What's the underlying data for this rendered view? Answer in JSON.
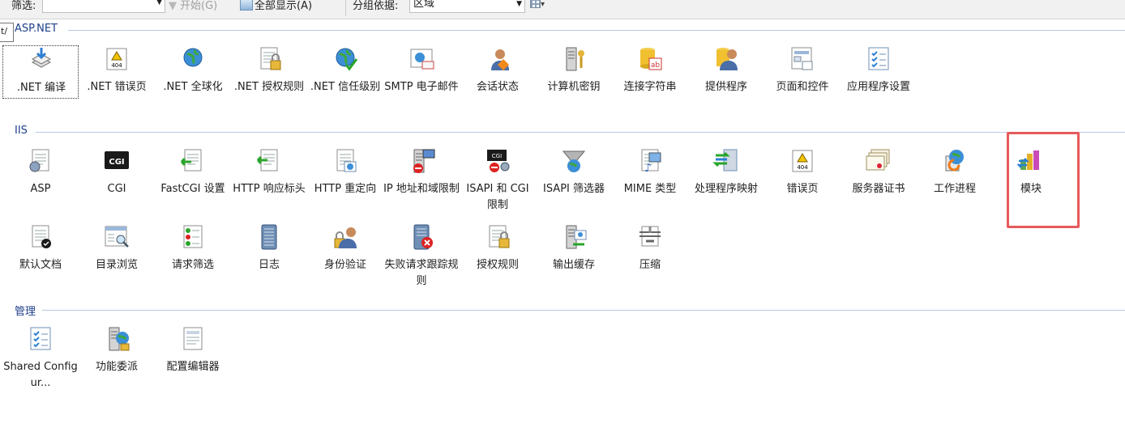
{
  "toolbar": {
    "filter_label": "筛选:",
    "go_label": "开始(G)",
    "show_all_label": "全部显示(A)",
    "group_by_label": "分组依据:",
    "group_by_value": "区域"
  },
  "tooltip_stub": "t/",
  "sections": [
    {
      "title": "ASP.NET",
      "items": [
        {
          "label": ".NET 编译",
          "icon": "net-compile-icon"
        },
        {
          "label": ".NET 错误页",
          "icon": "net-error-pages-icon"
        },
        {
          "label": ".NET 全球化",
          "icon": "net-globalization-icon"
        },
        {
          "label": ".NET 授权规则",
          "icon": "net-authorization-icon"
        },
        {
          "label": ".NET 信任级别",
          "icon": "net-trust-levels-icon"
        },
        {
          "label": "SMTP 电子邮件",
          "icon": "smtp-email-icon"
        },
        {
          "label": "会话状态",
          "icon": "session-state-icon"
        },
        {
          "label": "计算机密钥",
          "icon": "machine-key-icon"
        },
        {
          "label": "连接字符串",
          "icon": "connection-strings-icon"
        },
        {
          "label": "提供程序",
          "icon": "providers-icon"
        },
        {
          "label": "页面和控件",
          "icon": "pages-controls-icon"
        },
        {
          "label": "应用程序设置",
          "icon": "app-settings-icon"
        }
      ]
    },
    {
      "title": "IIS",
      "items": [
        {
          "label": "ASP",
          "icon": "asp-icon"
        },
        {
          "label": "CGI",
          "icon": "cgi-icon"
        },
        {
          "label": "FastCGI 设置",
          "icon": "fastcgi-icon"
        },
        {
          "label": "HTTP 响应标头",
          "icon": "http-response-headers-icon"
        },
        {
          "label": "HTTP 重定向",
          "icon": "http-redirect-icon"
        },
        {
          "label": "IP 地址和域限制",
          "icon": "ip-restrictions-icon"
        },
        {
          "label": "ISAPI 和 CGI 限制",
          "icon": "isapi-cgi-restrictions-icon"
        },
        {
          "label": "ISAPI 筛选器",
          "icon": "isapi-filters-icon"
        },
        {
          "label": "MIME 类型",
          "icon": "mime-types-icon"
        },
        {
          "label": "处理程序映射",
          "icon": "handler-mappings-icon"
        },
        {
          "label": "错误页",
          "icon": "error-pages-icon"
        },
        {
          "label": "服务器证书",
          "icon": "server-certificates-icon"
        },
        {
          "label": "工作进程",
          "icon": "worker-processes-icon"
        },
        {
          "label": "模块",
          "icon": "modules-icon"
        },
        {
          "label": "默认文档",
          "icon": "default-document-icon"
        },
        {
          "label": "目录浏览",
          "icon": "directory-browsing-icon"
        },
        {
          "label": "请求筛选",
          "icon": "request-filtering-icon"
        },
        {
          "label": "日志",
          "icon": "logging-icon"
        },
        {
          "label": "身份验证",
          "icon": "authentication-icon"
        },
        {
          "label": "失败请求跟踪规则",
          "icon": "failed-request-tracing-icon"
        },
        {
          "label": "授权规则",
          "icon": "authorization-rules-icon"
        },
        {
          "label": "输出缓存",
          "icon": "output-caching-icon"
        },
        {
          "label": "压缩",
          "icon": "compression-icon"
        }
      ]
    },
    {
      "title": "管理",
      "items": [
        {
          "label": "Shared Configur...",
          "icon": "shared-configuration-icon"
        },
        {
          "label": "功能委派",
          "icon": "feature-delegation-icon"
        },
        {
          "label": "配置编辑器",
          "icon": "configuration-editor-icon"
        }
      ]
    }
  ],
  "colors": {
    "section_title": "#1e3f8a",
    "section_line": "#b6c7e3",
    "highlight": "#e85a5a"
  }
}
